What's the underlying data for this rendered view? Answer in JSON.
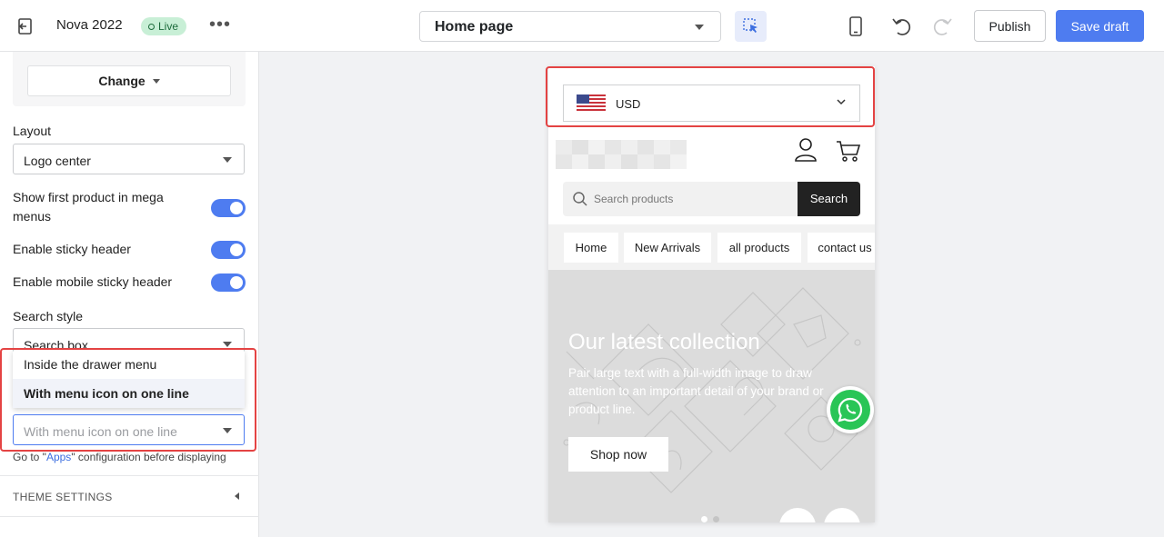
{
  "topbar": {
    "store_name": "Nova 2022",
    "live_badge": "Live",
    "more_label": "•••",
    "page_select": "Home page",
    "publish_label": "Publish",
    "save_label": "Save draft",
    "accent_color": "#4e7cf0"
  },
  "sidebar": {
    "change_label": "Change",
    "layout": {
      "label": "Layout",
      "value": "Logo center"
    },
    "toggles": [
      {
        "label": "Show first product in mega menus",
        "on": true
      },
      {
        "label": "Enable sticky header",
        "on": true
      },
      {
        "label": "Enable mobile sticky header",
        "on": true
      }
    ],
    "search_style": {
      "label": "Search style",
      "value": "Search box"
    },
    "dropdown": {
      "options": [
        "Inside the drawer menu",
        "With menu icon on one line"
      ],
      "selected": "With menu icon on one line"
    },
    "select_value": "With menu icon on one line",
    "apps_note": {
      "prefix": "Go to \"",
      "link": "Apps",
      "suffix": "\" configuration before displaying"
    },
    "theme_settings": "THEME SETTINGS"
  },
  "preview": {
    "currency": "USD",
    "search_placeholder": "Search products",
    "search_button": "Search",
    "nav": [
      "Home",
      "New Arrivals",
      "all products",
      "contact us"
    ],
    "hero": {
      "title": "Our latest collection",
      "text": "Pair large text with a full-width image to draw attention to an important detail of your brand or product line.",
      "button": "Shop now"
    },
    "slides": {
      "count": 2,
      "active": 1
    }
  },
  "highlight_color": "#e44343"
}
